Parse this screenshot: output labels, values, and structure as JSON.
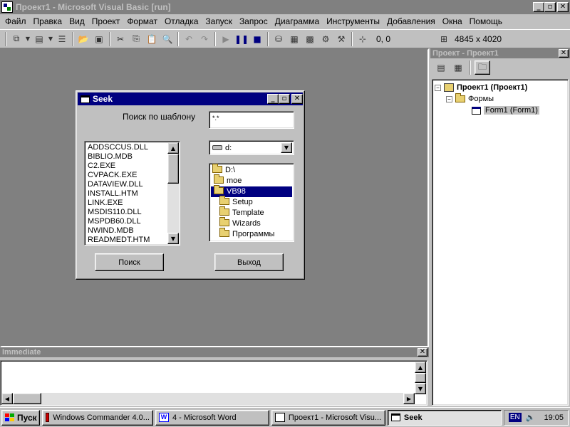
{
  "window": {
    "title": "Проект1 - Microsoft Visual Basic [run]",
    "icon": "vb-app-icon"
  },
  "menu": [
    "Файл",
    "Правка",
    "Вид",
    "Проект",
    "Формат",
    "Отладка",
    "Запуск",
    "Запрос",
    "Диаграмма",
    "Инструменты",
    "Добавления",
    "Окна",
    "Помощь"
  ],
  "toolbar": {
    "position": "0, 0",
    "size": "4845 x 4020"
  },
  "seek": {
    "title": "Seek",
    "pattern_label": "Поиск по шаблону",
    "pattern_value": "*.*",
    "files": [
      "ADDSCCUS.DLL",
      "BIBLIO.MDB",
      "C2.EXE",
      "CVPACK.EXE",
      "DATAVIEW.DLL",
      "INSTALL.HTM",
      "LINK.EXE",
      "MSDIS110.DLL",
      "MSPDB60.DLL",
      "NWIND.MDB",
      "READMEDT.HTM"
    ],
    "drive": "d:",
    "folders": [
      "D:\\",
      "moe",
      "VB98",
      "Setup",
      "Template",
      "Wizards",
      "Программы"
    ],
    "selected_folder": "VB98",
    "search_button": "Поиск",
    "exit_button": "Выход"
  },
  "project": {
    "title": "Проект - Проект1",
    "root": "Проект1 (Проект1)",
    "forms_folder": "Формы",
    "form": "Form1 (Form1)"
  },
  "immediate": {
    "title": "Immediate"
  },
  "taskbar": {
    "start": "Пуск",
    "tasks": [
      "Windows Commander 4.0...",
      "4 - Microsoft Word",
      "Проект1 - Microsoft Visu...",
      "Seek"
    ],
    "lang": "EN",
    "clock": "19:05"
  },
  "colors": {
    "active_title": "#000080",
    "inactive_title": "#808080",
    "mdi_background": "#808080",
    "face": "#c0c0c0"
  }
}
